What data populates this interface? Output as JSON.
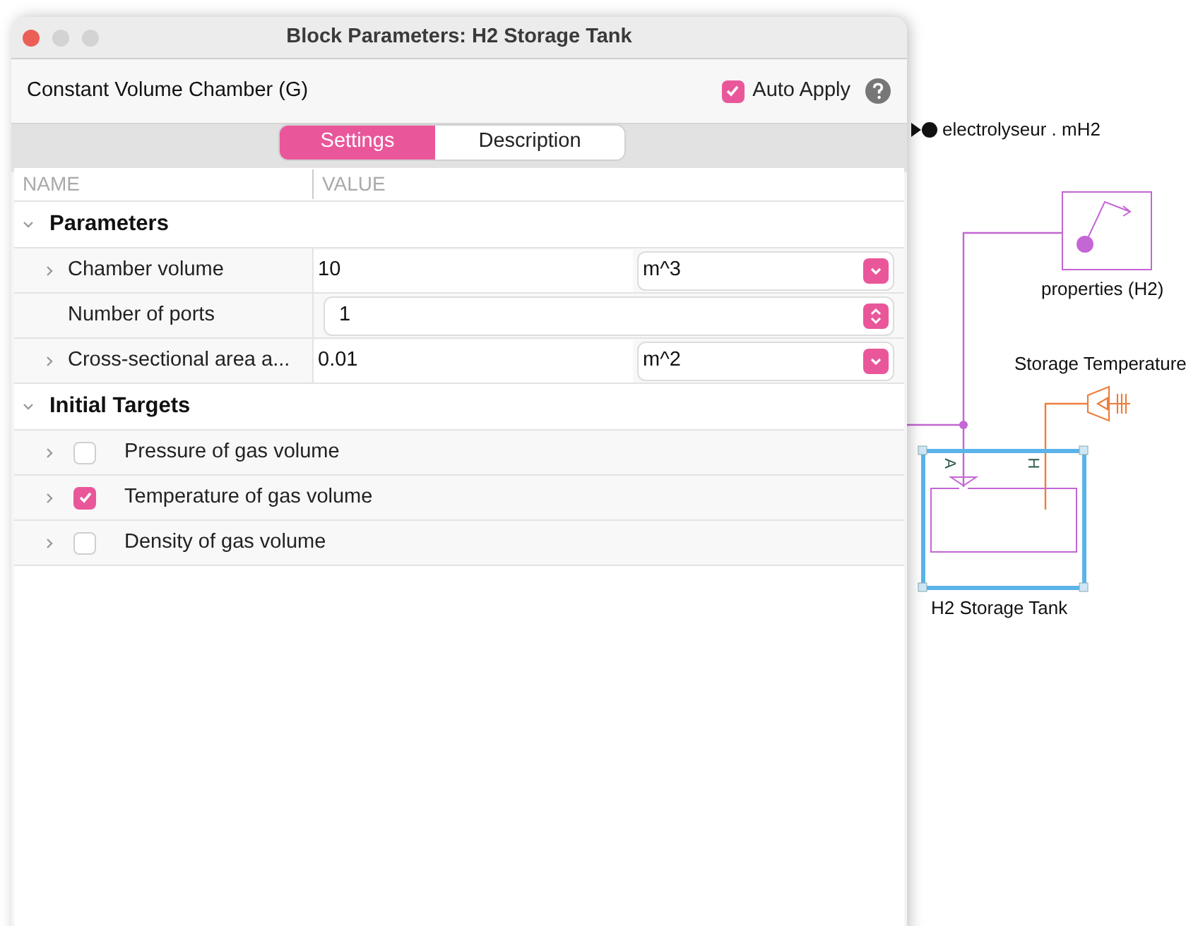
{
  "window": {
    "title": "Block Parameters: H2 Storage Tank"
  },
  "header": {
    "block_type": "Constant Volume Chamber (G)",
    "auto_apply": {
      "label": "Auto Apply",
      "checked": true
    }
  },
  "tabs": [
    {
      "label": "Settings",
      "selected": true
    },
    {
      "label": "Description",
      "selected": false
    }
  ],
  "columns": [
    "NAME",
    "VALUE"
  ],
  "sections": [
    {
      "title": "Parameters",
      "expanded": true,
      "rows": [
        {
          "kind": "unit",
          "name": "Chamber volume",
          "expandable": true,
          "value": "10",
          "unit": "m^3"
        },
        {
          "kind": "spinner",
          "name": "Number of ports",
          "expandable": false,
          "value": "1"
        },
        {
          "kind": "unit",
          "name": "Cross-sectional area a...",
          "expandable": true,
          "value": "0.01",
          "unit": "m^2"
        }
      ]
    },
    {
      "title": "Initial Targets",
      "expanded": true,
      "rows": [
        {
          "kind": "target",
          "name": "Pressure of gas volume",
          "expandable": true,
          "checked": false
        },
        {
          "kind": "target",
          "name": "Temperature of gas volume",
          "expandable": true,
          "checked": true
        },
        {
          "kind": "target",
          "name": "Density of gas volume",
          "expandable": true,
          "checked": false
        }
      ]
    }
  ],
  "diagram": {
    "signal_label": "electrolyseur . mH2",
    "properties_label": "properties (H2)",
    "temperature_label": "Storage Temperature",
    "port_a": "A",
    "port_h": "H",
    "block_label": "H2 Storage Tank",
    "block_selected": true
  }
}
